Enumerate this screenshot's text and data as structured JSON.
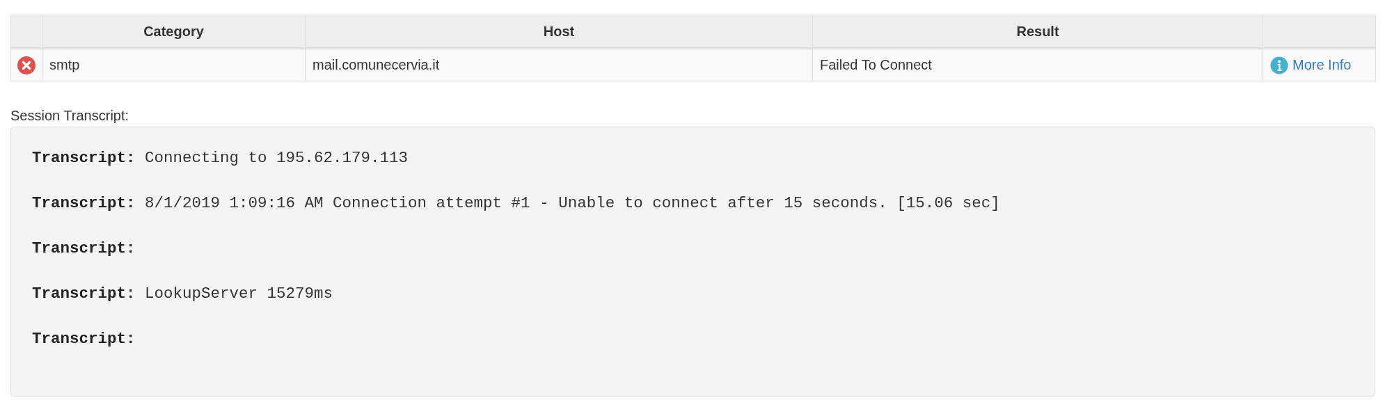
{
  "table": {
    "columns": [
      "",
      "Category",
      "Host",
      "Result",
      ""
    ],
    "rows": [
      {
        "failed": true,
        "category": "smtp",
        "host": "mail.comunecervia.it",
        "result": "Failed To Connect",
        "link": "More Info"
      }
    ]
  },
  "transcript": {
    "label": "Session Transcript:",
    "lines": [
      "**Transcript:** Connecting to 195.62.179.113",
      "**Transcript:** 8/1/2019 1:09:16 AM Connection attempt #1 - Unable to connect after 15 seconds. [15.06 sec]",
      "**Transcript:**",
      "**Transcript:** LookupServer 15279ms",
      "**Transcript:**"
    ]
  }
}
